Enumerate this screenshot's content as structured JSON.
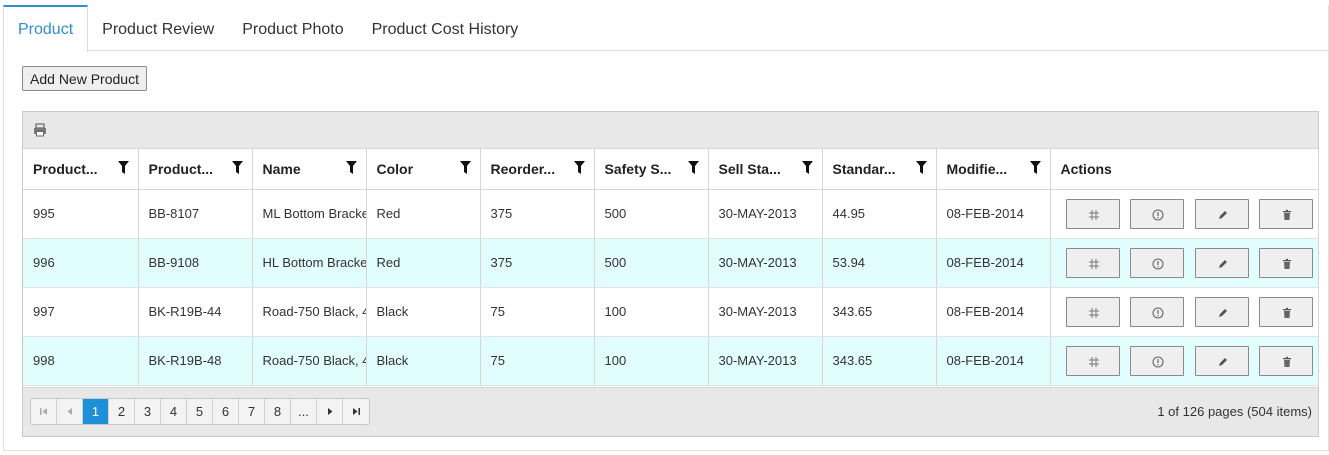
{
  "tabs": [
    "Product",
    "Product Review",
    "Product Photo",
    "Product Cost History"
  ],
  "active_tab": 0,
  "add_button_label": "Add New Product",
  "grid": {
    "toolbar": {
      "print_icon": "printer-icon"
    },
    "columns": [
      {
        "label": "Product..."
      },
      {
        "label": "Product..."
      },
      {
        "label": "Name"
      },
      {
        "label": "Color"
      },
      {
        "label": "Reorder..."
      },
      {
        "label": "Safety S..."
      },
      {
        "label": "Sell Sta..."
      },
      {
        "label": "Standar..."
      },
      {
        "label": "Modifie..."
      },
      {
        "label": "Actions"
      }
    ],
    "rows": [
      {
        "cells": [
          "995",
          "BB-8107",
          "ML Bottom Bracke",
          "Red",
          "375",
          "500",
          "30-MAY-2013",
          "44.95",
          "08-FEB-2014"
        ]
      },
      {
        "cells": [
          "996",
          "BB-9108",
          "HL Bottom Bracke",
          "Red",
          "375",
          "500",
          "30-MAY-2013",
          "53.94",
          "08-FEB-2014"
        ]
      },
      {
        "cells": [
          "997",
          "BK-R19B-44",
          "Road-750 Black, 4",
          "Black",
          "75",
          "100",
          "30-MAY-2013",
          "343.65",
          "08-FEB-2014"
        ]
      },
      {
        "cells": [
          "998",
          "BK-R19B-48",
          "Road-750 Black, 4",
          "Black",
          "75",
          "100",
          "30-MAY-2013",
          "343.65",
          "08-FEB-2014"
        ]
      }
    ],
    "action_icons": [
      "link-icon",
      "info-icon",
      "edit-icon",
      "delete-icon"
    ]
  },
  "pager": {
    "pages": [
      "1",
      "2",
      "3",
      "4",
      "5",
      "6",
      "7",
      "8",
      "..."
    ],
    "current_page": "1",
    "info": "1 of 126 pages (504 items)"
  },
  "colors": {
    "accent": "#2f8fd0",
    "row_alt": "#e1fdfd",
    "page_active": "#1e90d8"
  }
}
